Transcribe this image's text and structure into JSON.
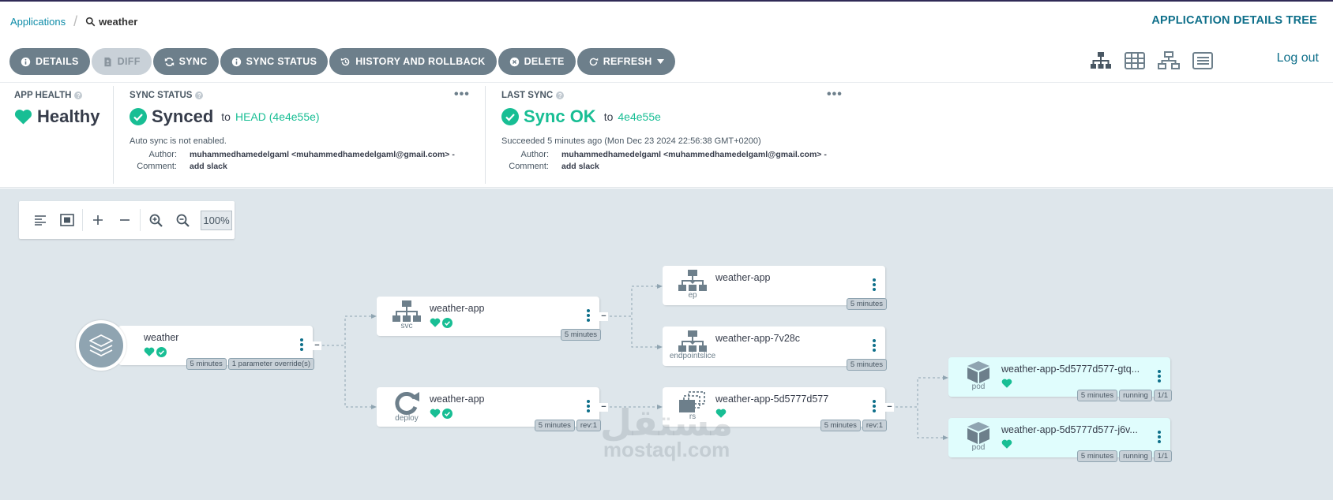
{
  "breadcrumbs": {
    "root": "Applications",
    "current": "weather"
  },
  "view_title": "APPLICATION DETAILS TREE",
  "toolbar": {
    "details": "DETAILS",
    "diff": "DIFF",
    "sync": "SYNC",
    "sync_status": "SYNC STATUS",
    "history": "HISTORY AND ROLLBACK",
    "delete": "DELETE",
    "refresh": "REFRESH"
  },
  "logout": "Log out",
  "app_health": {
    "title": "APP HEALTH",
    "value": "Healthy"
  },
  "sync_status": {
    "title": "SYNC STATUS",
    "value": "Synced",
    "to": "to",
    "revision": "HEAD (4e4e55e)",
    "note": "Auto sync is not enabled.",
    "author_label": "Author:",
    "author": "muhammedhamedelgaml <muhammedhamedelgaml@gmail.com> -",
    "comment_label": "Comment:",
    "comment": "add slack"
  },
  "last_sync": {
    "title": "LAST SYNC",
    "value": "Sync OK",
    "to": "to",
    "revision": "4e4e55e",
    "note": "Succeeded 5 minutes ago (Mon Dec 23 2024 22:56:38 GMT+0200)",
    "author_label": "Author:",
    "author": "muhammedhamedelgaml <muhammedhamedelgaml@gmail.com> -",
    "comment_label": "Comment:",
    "comment": "add slack"
  },
  "zoom": {
    "level": "100%"
  },
  "nodes": {
    "app": {
      "name": "weather",
      "tags": [
        "5 minutes",
        "1 parameter override(s)"
      ]
    },
    "svc": {
      "name": "weather-app",
      "kind": "svc",
      "tags": [
        "5 minutes"
      ]
    },
    "deploy": {
      "name": "weather-app",
      "kind": "deploy",
      "tags": [
        "5 minutes",
        "rev:1"
      ]
    },
    "ep": {
      "name": "weather-app",
      "kind": "ep",
      "tags": [
        "5 minutes"
      ]
    },
    "epslice": {
      "name": "weather-app-7v28c",
      "kind": "endpointslice",
      "tags": [
        "5 minutes"
      ]
    },
    "rs": {
      "name": "weather-app-5d5777d577",
      "kind": "rs",
      "tags": [
        "5 minutes",
        "rev:1"
      ]
    },
    "pod1": {
      "name": "weather-app-5d5777d577-gtq...",
      "kind": "pod",
      "tags": [
        "5 minutes",
        "running",
        "1/1"
      ]
    },
    "pod2": {
      "name": "weather-app-5d5777d577-j6v...",
      "kind": "pod",
      "tags": [
        "5 minutes",
        "running",
        "1/1"
      ]
    }
  },
  "watermark": {
    "arabic": "مستقل",
    "latin": "mostaql.com"
  },
  "colors": {
    "accent": "#0e8ca8",
    "green": "#18be94",
    "button": "#6d7f8b",
    "canvas": "#dee6eb"
  }
}
